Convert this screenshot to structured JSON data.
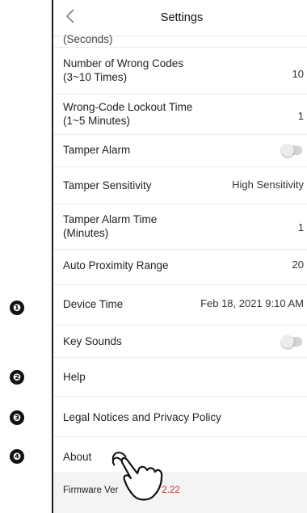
{
  "header": {
    "title": "Settings",
    "back_icon": "chevron-left-icon"
  },
  "rows": {
    "partial_top": "(Seconds)",
    "wrong_codes": {
      "label_line1": "Number of Wrong Codes",
      "label_line2": "(3~10 Times)",
      "value": "10"
    },
    "lockout_time": {
      "label_line1": "Wrong-Code Lockout Time",
      "label_line2": "(1~5 Minutes)",
      "value": "1"
    },
    "tamper_alarm": {
      "label": "Tamper Alarm",
      "toggle_on": false
    },
    "tamper_sensitivity": {
      "label": "Tamper Sensitivity",
      "value": "High Sensitivity"
    },
    "tamper_alarm_time": {
      "label_line1": "Tamper Alarm Time",
      "label_line2": "(Minutes)",
      "value": "1"
    },
    "auto_proximity": {
      "label": "Auto Proximity Range",
      "value": "20"
    },
    "device_time": {
      "label": "Device Time",
      "value": "Feb 18, 2021 9:10 AM"
    },
    "key_sounds": {
      "label": "Key Sounds",
      "toggle_on": false
    },
    "help": {
      "label": "Help"
    },
    "legal": {
      "label": "Legal Notices and Privacy Policy"
    },
    "about": {
      "label": "About"
    },
    "firmware": {
      "label": "Firmware Ver",
      "version": "2.22"
    }
  },
  "markers": [
    "❶",
    "❷",
    "❸",
    "❹"
  ],
  "colors": {
    "firmware_version": "#d0302a",
    "toggle_track": "#d4d4d4"
  }
}
